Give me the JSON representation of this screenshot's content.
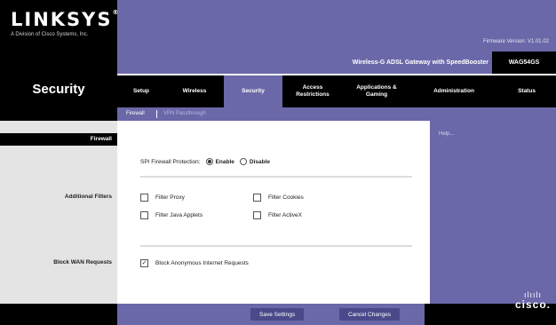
{
  "brand": {
    "logo": "LINKSYS",
    "logo_mark": "®",
    "tagline": "A Division of Cisco Systems, Inc.",
    "firmware": "Firmware Version: V1.01.02"
  },
  "product": {
    "name": "Wireless-G ADSL Gateway with SpeedBooster",
    "model": "WAG54GS"
  },
  "section_title": "Security",
  "tabs": [
    {
      "label": "Setup"
    },
    {
      "label": "Wireless"
    },
    {
      "label": "Security",
      "active": true
    },
    {
      "label": "Access\nRestrictions"
    },
    {
      "label": "Applications &\nGaming"
    },
    {
      "label": "Administration"
    },
    {
      "label": "Status"
    }
  ],
  "subtabs": {
    "active": "Firewall",
    "inactive": "VPN Passthrough"
  },
  "left_labels": {
    "firewall": "Firewall",
    "additional_filters": "Additional Filters",
    "block_wan": "Block WAN Requests"
  },
  "spi": {
    "label": "SPI Firewall Protection:",
    "enable": "Enable",
    "disable": "Disable",
    "selected": "Enable"
  },
  "filters": {
    "proxy": {
      "label": "Filter Proxy",
      "checked": false
    },
    "cookies": {
      "label": "Filter Cookies",
      "checked": false
    },
    "java": {
      "label": "Filter Java Applets",
      "checked": false
    },
    "activex": {
      "label": "Filter ActiveX",
      "checked": false
    }
  },
  "block": {
    "label": "Block Anonymous Internet Requests",
    "checked": true
  },
  "help": {
    "label": "Help..."
  },
  "buttons": {
    "save": "Save Settings",
    "cancel": "Cancel Changes"
  },
  "cisco": {
    "bars": "ılıılı",
    "word": "cisco."
  },
  "colors": {
    "accent": "#6a68a8",
    "dark": "#000000",
    "panel": "#e4e4e4"
  }
}
